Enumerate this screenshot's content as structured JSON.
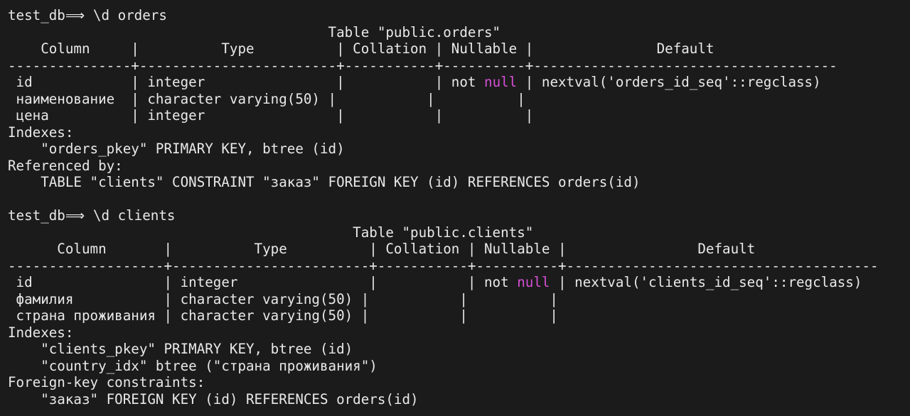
{
  "terminal": {
    "lines": [
      {
        "text": "test_db⟹ \\d orders"
      },
      {
        "text": "                                       Table \"public.orders\""
      },
      {
        "text": "    Column     |          Type          | Collation | Nullable |               Default"
      },
      {
        "text": "---------------+------------------------+-----------+----------+-------------------------------------"
      },
      {
        "pre": " id            | integer                |           | not ",
        "kw": "null",
        "post": " | nextval('orders_id_seq'::regclass)"
      },
      {
        "text": " наименование  | character varying(50) |           |          |"
      },
      {
        "text": " цена          | integer                |           |          |"
      },
      {
        "text": "Indexes:"
      },
      {
        "text": "    \"orders_pkey\" PRIMARY KEY, btree (id)"
      },
      {
        "text": "Referenced by:"
      },
      {
        "text": "    TABLE \"clients\" CONSTRAINT \"заказ\" FOREIGN KEY (id) REFERENCES orders(id)"
      },
      {
        "text": ""
      },
      {
        "text": "test_db⟹ \\d clients"
      },
      {
        "text": "                                          Table \"public.clients\""
      },
      {
        "text": "      Column       |          Type          | Collation | Nullable |                Default"
      },
      {
        "text": "-------------------+------------------------+-----------+----------+--------------------------------------"
      },
      {
        "pre": " id                | integer                |           | not ",
        "kw": "null",
        "post": " | nextval('clients_id_seq'::regclass)"
      },
      {
        "text": " фамилия           | character varying(50) |           |          |"
      },
      {
        "text": " страна проживания | character varying(50) |           |          |"
      },
      {
        "text": "Indexes:"
      },
      {
        "text": "    \"clients_pkey\" PRIMARY KEY, btree (id)"
      },
      {
        "text": "    \"country_idx\" btree (\"страна проживания\")"
      },
      {
        "text": "Foreign-key constraints:"
      },
      {
        "text": "    \"заказ\" FOREIGN KEY (id) REFERENCES orders(id)"
      }
    ]
  },
  "colors": {
    "background": "#1b1b1b",
    "foreground": "#e9e9e9",
    "keyword": "#d54fd5"
  }
}
